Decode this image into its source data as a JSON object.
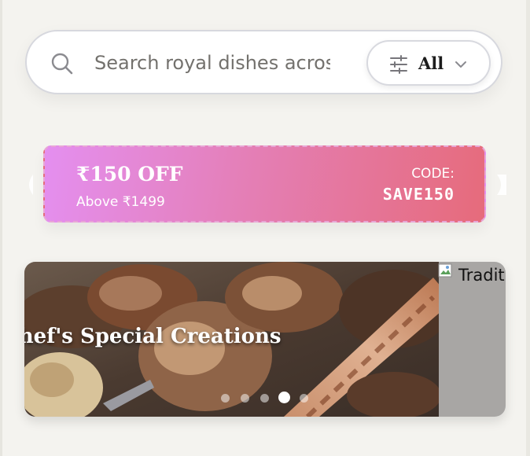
{
  "search": {
    "placeholder": "Search royal dishes across"
  },
  "filter": {
    "label": "All",
    "icon": "sliders-icon",
    "chevron_icon": "chevron-down-icon"
  },
  "coupon": {
    "amount": "₹150 OFF",
    "min_order": "Above ₹1499",
    "code_label": "CODE:",
    "code": "SAVE150"
  },
  "banner": {
    "title": "Chef's Special Creations",
    "next_image_alt": "Traditional",
    "slide_count": 5,
    "active_slide": 4
  },
  "colors": {
    "coupon_start": "#e48ff0",
    "coupon_end": "#e66b7b",
    "background": "#f4f3ef"
  }
}
